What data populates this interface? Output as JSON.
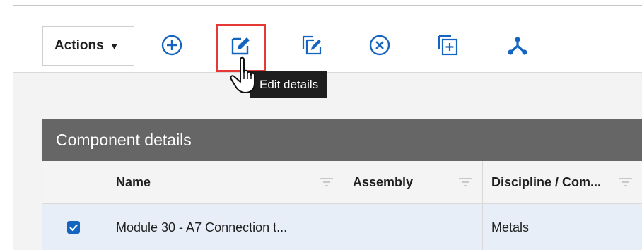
{
  "toolbar": {
    "actions_label": "Actions",
    "icons": [
      "add-circle-icon",
      "edit-icon",
      "edit-multiple-icon",
      "cancel-circle-icon",
      "add-copy-icon",
      "merge-icon"
    ],
    "icon_color": "#1565c0",
    "highlight_color": "#e53935"
  },
  "tooltip": {
    "text": "Edit details"
  },
  "panel": {
    "title": "Component details",
    "header_bg": "#666666"
  },
  "grid": {
    "columns": [
      "",
      "Name",
      "Assembly",
      "Discipline / Com..."
    ],
    "rows": [
      {
        "checked": true,
        "name": "Module 30 - A7 Connection t...",
        "assembly": "",
        "discipline": "Metals"
      }
    ],
    "selected_row_bg": "#e8eef8"
  }
}
